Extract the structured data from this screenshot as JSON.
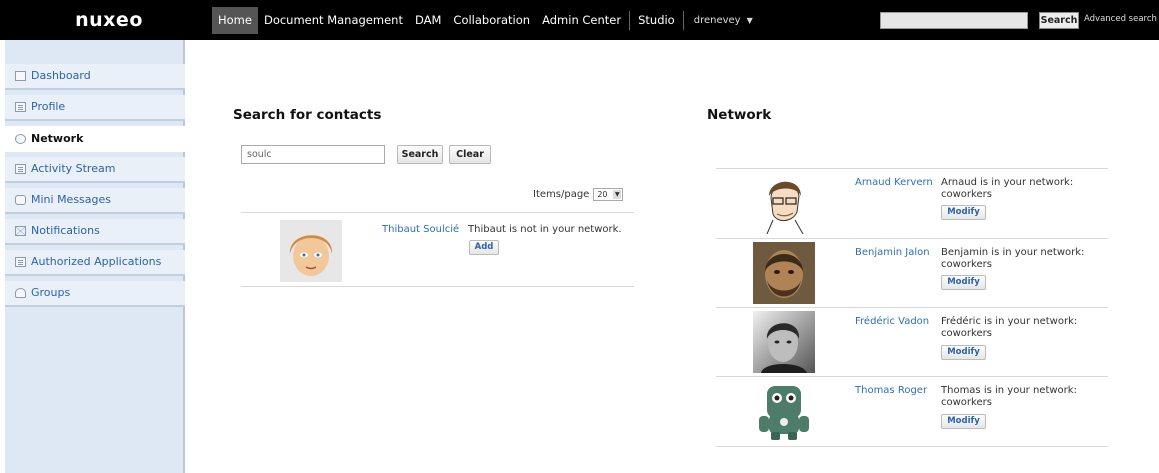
{
  "topbar": {
    "logo": "nuxeo",
    "nav": [
      "Home",
      "Document Management",
      "DAM",
      "Collaboration",
      "Admin Center"
    ],
    "studio": "Studio",
    "user": "drenevey",
    "search_button": "Search",
    "advanced_search": "Advanced search"
  },
  "sidebar": {
    "items": [
      {
        "label": "Dashboard",
        "icon": "dashboard-icon"
      },
      {
        "label": "Profile",
        "icon": "profile-icon"
      },
      {
        "label": "Network",
        "icon": "network-icon"
      },
      {
        "label": "Activity Stream",
        "icon": "activity-stream-icon"
      },
      {
        "label": "Mini Messages",
        "icon": "mini-messages-icon"
      },
      {
        "label": "Notifications",
        "icon": "notifications-icon"
      },
      {
        "label": "Authorized Applications",
        "icon": "authorized-applications-icon"
      },
      {
        "label": "Groups",
        "icon": "groups-icon"
      }
    ],
    "active": "Network"
  },
  "search": {
    "title": "Search for contacts",
    "query": "soulc",
    "search_button": "Search",
    "clear_button": "Clear",
    "items_per_page_label": "Items/page",
    "items_per_page_value": "20",
    "results": [
      {
        "name": "Thibaut Soulcié",
        "status": "Thibaut is not in your network.",
        "action": "Add"
      }
    ]
  },
  "network": {
    "title": "Network",
    "contacts": [
      {
        "name": "Arnaud Kervern",
        "status_line1": "Arnaud is in your network:",
        "status_line2": "coworkers",
        "action": "Modify"
      },
      {
        "name": "Benjamin Jalon",
        "status_line1": "Benjamin is in your network:",
        "status_line2": "coworkers",
        "action": "Modify"
      },
      {
        "name": "Frédéric Vadon",
        "status_line1": "Frédéric is in your network:",
        "status_line2": "coworkers",
        "action": "Modify"
      },
      {
        "name": "Thomas Roger",
        "status_line1": "Thomas is in your network:",
        "status_line2": "coworkers",
        "action": "Modify"
      }
    ]
  },
  "colors": {
    "topbar": "#000000",
    "sidebar": "#dde8f4",
    "link": "#2c6fb5"
  }
}
